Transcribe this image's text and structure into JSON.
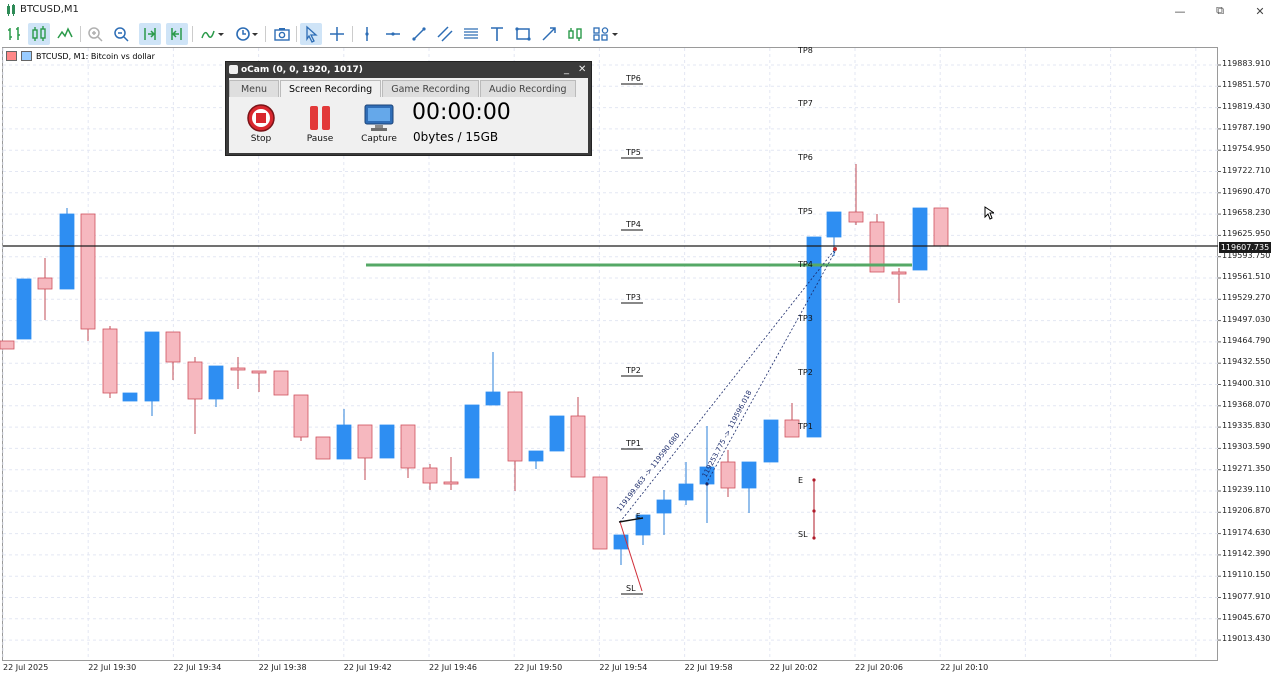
{
  "window": {
    "title": "BTCUSD,M1"
  },
  "chart": {
    "caption": "BTCUSD, M1:  Bitcoin vs dollar",
    "current_price": "119607.735",
    "y_ticks": [
      "119883.910",
      "119851.570",
      "119819.430",
      "119787.190",
      "119754.950",
      "119722.710",
      "119690.470",
      "119658.230",
      "119625.950",
      "119593.750",
      "119561.510",
      "119529.270",
      "119497.030",
      "119464.790",
      "119432.550",
      "119400.310",
      "119368.070",
      "119335.830",
      "119303.590",
      "119271.350",
      "119239.110",
      "119206.870",
      "119174.630",
      "119142.390",
      "119110.150",
      "119077.910",
      "119045.670",
      "119013.430"
    ],
    "x_ticks": [
      "22 Jul 2025",
      "22 Jul 19:30",
      "22 Jul 19:34",
      "22 Jul 19:38",
      "22 Jul 19:42",
      "22 Jul 19:46",
      "22 Jul 19:50",
      "22 Jul 19:54",
      "22 Jul 19:58",
      "22 Jul 20:02",
      "22 Jul 20:06",
      "22 Jul 20:10"
    ],
    "left_levels": [
      "TP6",
      "TP5",
      "TP4",
      "TP3",
      "TP2",
      "TP1",
      "SL"
    ],
    "right_levels": [
      "TP8",
      "TP7",
      "TP6",
      "TP5",
      "TP4",
      "TP3",
      "TP2",
      "TP1",
      "E",
      "SL"
    ],
    "trend_label_1": "119199.863 -> 119590.680",
    "trend_label_2": "119253.775 -> 119596.018",
    "entry_marker": "E",
    "colors": {
      "bull": "#2e8ef2",
      "bear": "#f6b8bf",
      "bear_edge": "#d0525e",
      "level_line": "#55a866",
      "price_line": "#1c1c1c",
      "grid": "#e3e7f3"
    }
  },
  "ocam": {
    "title": "oCam (0, 0, 1920, 1017)",
    "minimize": "_",
    "close": "✕",
    "tabs": [
      "Menu",
      "Screen Recording",
      "Game Recording",
      "Audio Recording"
    ],
    "active_tab": "Screen Recording",
    "buttons": {
      "stop": "Stop",
      "pause": "Pause",
      "capture": "Capture"
    },
    "timer": "00:00:00",
    "size": "0bytes / 15GB"
  },
  "icons": [
    "app-icon",
    "bar-chart-icon",
    "candles-icon",
    "line-chart-icon",
    "zoom-in-icon",
    "zoom-out-icon",
    "autoscroll-icon",
    "chart-shift-icon",
    "indicators-icon",
    "periods-icon",
    "screenshot-icon",
    "cursor-icon",
    "crosshair-icon",
    "vertical-line-icon",
    "horizontal-line-icon",
    "trendline-icon",
    "channel-icon",
    "fibonacci-icon",
    "text-icon",
    "rectangle-icon",
    "arrow-icon",
    "signal-icon",
    "shapes-icon",
    "minimize-icon",
    "maximize-icon",
    "close-icon"
  ]
}
